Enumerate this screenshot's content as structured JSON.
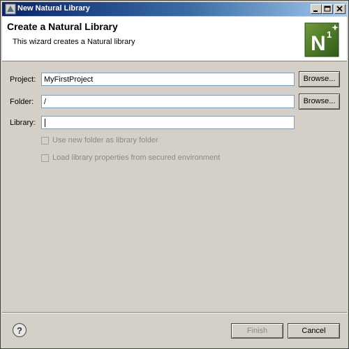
{
  "window": {
    "title": "New Natural Library"
  },
  "banner": {
    "title": "Create a Natural Library",
    "description": "This wizard creates a Natural library",
    "logo_text": "N",
    "logo_superscript": "1"
  },
  "form": {
    "project": {
      "label": "Project:",
      "value": "MyFirstProject",
      "browse_label": "Browse..."
    },
    "folder": {
      "label": "Folder:",
      "value": "/",
      "browse_label": "Browse..."
    },
    "library": {
      "label": "Library:",
      "value": ""
    },
    "use_new_folder_label": "Use new folder as library folder",
    "load_props_label": "Load library properties from secured environment"
  },
  "footer": {
    "finish_label": "Finish",
    "cancel_label": "Cancel"
  },
  "icons": {
    "help": "help-icon",
    "app": "eclipse-window-icon",
    "logo": "natural-logo-icon"
  }
}
